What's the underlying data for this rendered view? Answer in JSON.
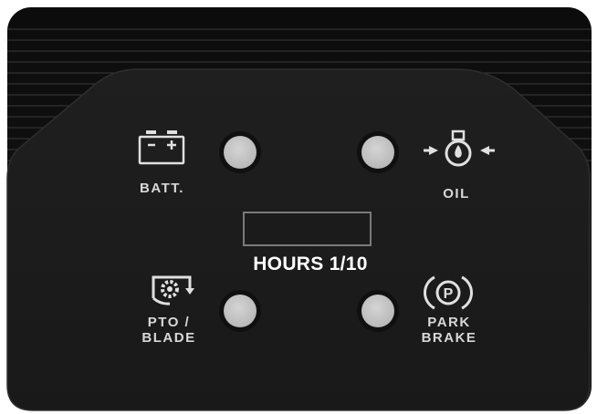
{
  "panel": {
    "labels": {
      "battery": "BATT.",
      "oil": "OIL",
      "pto_blade": "PTO /\nBLADE",
      "park_brake": "PARK\nBRAKE"
    },
    "hour_meter": {
      "label": "HOURS 1/10"
    }
  },
  "indicators": [
    {
      "id": "battery",
      "state": "off"
    },
    {
      "id": "oil",
      "state": "off"
    },
    {
      "id": "pto",
      "state": "off"
    },
    {
      "id": "park-brake",
      "state": "off"
    }
  ],
  "icons": [
    "battery-icon",
    "oil-pressure-icon",
    "pto-icon",
    "park-brake-icon"
  ],
  "colors": {
    "panel": "#1a1a1a",
    "lamp": "#c9c9c9",
    "label": "#d8d8d8",
    "hours_text": "#ffffff"
  }
}
